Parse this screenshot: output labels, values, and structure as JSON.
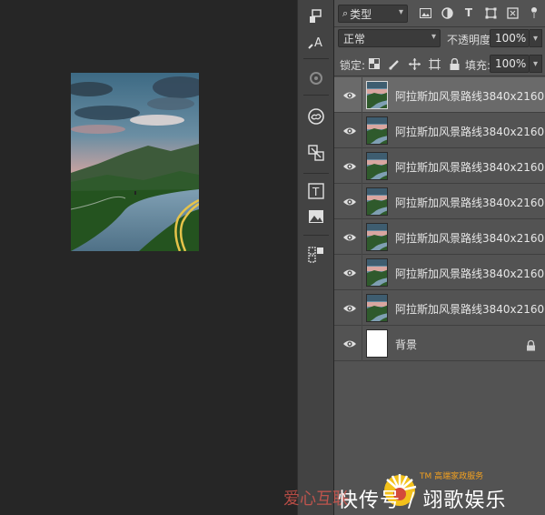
{
  "toolbar": {
    "tools": [
      {
        "icon": "stamp-icon"
      },
      {
        "icon": "brush-text-icon"
      },
      {
        "icon": "gear-3d-icon"
      },
      {
        "icon": "creative-cloud-icon"
      },
      {
        "icon": "swap-icon"
      },
      {
        "icon": "type-tool-icon"
      },
      {
        "icon": "image-icon"
      },
      {
        "icon": "shape-select-icon"
      }
    ]
  },
  "layers_panel": {
    "filter": {
      "label": "类型",
      "icon": "search-icon"
    },
    "filter_icons": [
      "image-filter-icon",
      "circle-filter-icon",
      "type-filter-icon",
      "shape-filter-icon",
      "smart-filter-icon"
    ],
    "blend_mode": "正常",
    "opacity_label": "不透明度:",
    "opacity_value": "100%",
    "lock_label": "锁定:",
    "fill_label": "填充:",
    "fill_value": "100%",
    "layers": [
      {
        "name": "阿拉斯加风景路线3840x2160...",
        "selected": true
      },
      {
        "name": "阿拉斯加风景路线3840x2160...",
        "selected": false
      },
      {
        "name": "阿拉斯加风景路线3840x2160...",
        "selected": false
      },
      {
        "name": "阿拉斯加风景路线3840x2160...",
        "selected": false
      },
      {
        "name": "阿拉斯加风景路线3840x2160...",
        "selected": false
      },
      {
        "name": "阿拉斯加风景路线3840x2160...",
        "selected": false
      },
      {
        "name": "阿拉斯加风景路线3840x2160...",
        "selected": false
      },
      {
        "name": "背景",
        "selected": false,
        "locked": true
      }
    ]
  },
  "watermark": {
    "brand": "爱心互联",
    "tm_text": "TM 高端家政服务",
    "main": "快传号 / 翊歌娱乐"
  },
  "colors": {
    "canvas_bg": "#262626",
    "panel_bg": "#535353",
    "toolbar_bg": "#434343",
    "selected_layer": "#6a6a6a"
  }
}
